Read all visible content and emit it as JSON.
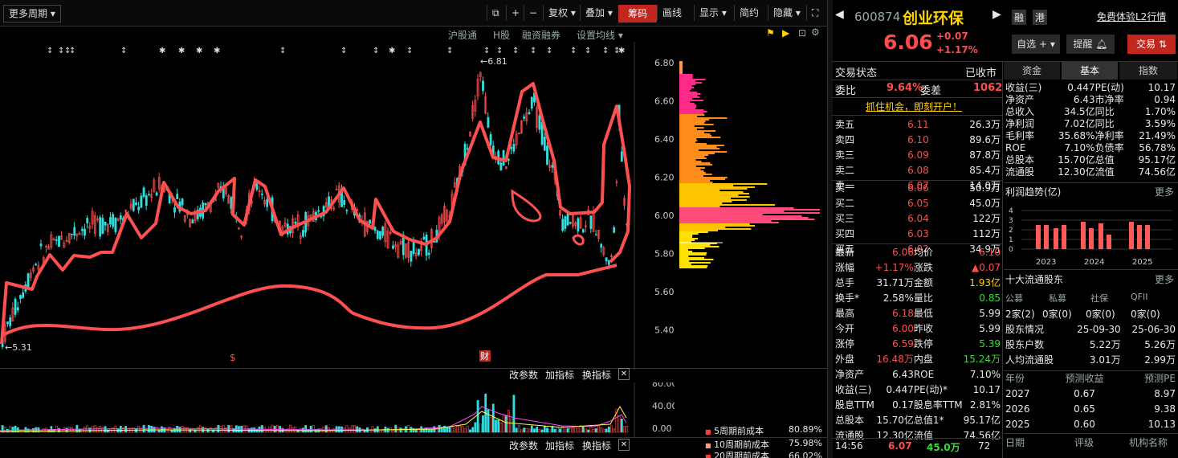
{
  "toolbar": {
    "period": "更多周期",
    "restore": "复权",
    "overlay": "叠加",
    "chips": "筹码",
    "draw": "画线",
    "display": "显示",
    "simple": "简约",
    "hide": "隐藏"
  },
  "subbar": {
    "hk_connect": "沪股通",
    "h_share": "H股",
    "margin": "融资融券",
    "ma_setting": "设置均线"
  },
  "price_axis": [
    "6.80",
    "6.60",
    "6.40",
    "6.20",
    "6.00",
    "5.80",
    "5.60",
    "5.40"
  ],
  "markers": {
    "high": "6.81",
    "low": "5.31",
    "s_badge": "$",
    "cai_badge": "财"
  },
  "indicator": {
    "change_param": "改参数",
    "add_ind": "加指标",
    "swap_ind": "换指标",
    "close": "✕",
    "axis": [
      "80.00",
      "40.00",
      "0.00"
    ]
  },
  "cost": {
    "rows": [
      {
        "label": "5周期前成本",
        "value": "80.89%"
      },
      {
        "label": "10周期前成本",
        "value": "75.98%"
      },
      {
        "label": "20周期前成本",
        "value": "66.02%"
      }
    ]
  },
  "stock": {
    "code": "600874",
    "name": "创业环保",
    "price": "6.06",
    "change": "+0.07",
    "pct": "+1.17%",
    "rong": "融",
    "gang": "港",
    "l2": "免费体验L2行情",
    "watch": "自选",
    "remind": "提醒",
    "trade": "交易"
  },
  "status": {
    "label": "交易状态",
    "value": "已收市",
    "wb_label": "委比",
    "wb": "9.64%",
    "wc_label": "委差",
    "wc": "1062",
    "banner": "抓住机会，即刻开户！"
  },
  "asks": [
    {
      "label": "卖五",
      "price": "6.11",
      "vol": "26.3万"
    },
    {
      "label": "卖四",
      "price": "6.10",
      "vol": "89.6万"
    },
    {
      "label": "卖三",
      "price": "6.09",
      "vol": "87.8万"
    },
    {
      "label": "卖二",
      "price": "6.08",
      "vol": "85.4万"
    },
    {
      "label": "卖一",
      "price": "6.07",
      "vol": "14.0万"
    }
  ],
  "bids": [
    {
      "label": "买一",
      "price": "6.06",
      "vol": "50.9万"
    },
    {
      "label": "买二",
      "price": "6.05",
      "vol": "45.0万"
    },
    {
      "label": "买三",
      "price": "6.04",
      "vol": "122万"
    },
    {
      "label": "买四",
      "price": "6.03",
      "vol": "112万"
    },
    {
      "label": "买五",
      "price": "6.02",
      "vol": "34.9万"
    }
  ],
  "stats": [
    {
      "l1": "最新",
      "v1": "6.06",
      "c1": "red",
      "l2": "均价",
      "v2": "6.10",
      "c2": "red"
    },
    {
      "l1": "涨幅",
      "v1": "+1.17%",
      "c1": "red",
      "l2": "涨跌",
      "v2": "▲0.07",
      "c2": "red"
    },
    {
      "l1": "总手",
      "v1": "31.71万",
      "c1": "white",
      "l2": "金额",
      "v2": "1.93亿",
      "c2": "yellow"
    },
    {
      "l1": "换手*",
      "v1": "2.58%",
      "c1": "white",
      "l2": "量比",
      "v2": "0.85",
      "c2": "green"
    },
    {
      "l1": "最高",
      "v1": "6.18",
      "c1": "red",
      "l2": "最低",
      "v2": "5.99",
      "c2": "white"
    },
    {
      "l1": "今开",
      "v1": "6.00",
      "c1": "red",
      "l2": "昨收",
      "v2": "5.99",
      "c2": "white"
    },
    {
      "l1": "涨停",
      "v1": "6.59",
      "c1": "red",
      "l2": "跌停",
      "v2": "5.39",
      "c2": "green"
    },
    {
      "l1": "外盘",
      "v1": "16.48万",
      "c1": "red",
      "l2": "内盘",
      "v2": "15.24万",
      "c2": "green"
    },
    {
      "l1": "净资产",
      "v1": "6.43",
      "c1": "white",
      "l2": "ROE",
      "v2": "7.10%",
      "c2": "white"
    },
    {
      "l1": "收益(三)",
      "v1": "0.447",
      "c1": "white",
      "l2": "PE(动)*",
      "v2": "10.17",
      "c2": "white"
    },
    {
      "l1": "股息TTM",
      "v1": "0.17",
      "c1": "white",
      "l2": "股息率TTM",
      "v2": "2.81%",
      "c2": "white"
    },
    {
      "l1": "总股本",
      "v1": "15.70亿",
      "c1": "white",
      "l2": "总值1*",
      "v2": "95.17亿",
      "c2": "white"
    },
    {
      "l1": "流通股",
      "v1": "12.30亿",
      "c1": "white",
      "l2": "流值",
      "v2": "74.56亿",
      "c2": "white"
    }
  ],
  "tick": {
    "time": "14:56",
    "price": "6.07",
    "vol": "45.0万",
    "count": "72"
  },
  "tabs": [
    "资金",
    "基本",
    "指数"
  ],
  "fund": [
    {
      "l1": "收益(三)",
      "v1": "0.447",
      "l2": "PE(动)",
      "v2": "10.17"
    },
    {
      "l1": "净资产",
      "v1": "6.43",
      "l2": "市净率",
      "v2": "0.94"
    },
    {
      "l1": "总收入",
      "v1": "34.5亿",
      "l2": "同比",
      "v2": "1.70%"
    },
    {
      "l1": "净利润",
      "v1": "7.02亿",
      "l2": "同比",
      "v2": "3.59%"
    },
    {
      "l1": "毛利率",
      "v1": "35.68%",
      "l2": "净利率",
      "v2": "21.49%"
    },
    {
      "l1": "ROE",
      "v1": "7.10%",
      "l2": "负债率",
      "v2": "56.78%"
    },
    {
      "l1": "总股本",
      "v1": "15.70亿",
      "l2": "总值",
      "v2": "95.17亿"
    },
    {
      "l1": "流通股",
      "v1": "12.30亿",
      "l2": "流值",
      "v2": "74.56亿"
    }
  ],
  "profit": {
    "title": "利润趋势(亿)",
    "more": "更多",
    "axis": [
      "4",
      "3",
      "2",
      "1",
      "0"
    ],
    "years": [
      "2023",
      "2024",
      "2025"
    ]
  },
  "holders": {
    "title": "十大流通股东",
    "more": "更多",
    "heads": [
      "公募",
      "私募",
      "社保",
      "QFII"
    ],
    "vals": [
      "2家(2)",
      "0家(0)",
      "0家(0)",
      "0家(0)"
    ],
    "rows": [
      {
        "l": "股东情况",
        "a": "25-09-30",
        "b": "25-06-30"
      },
      {
        "l": "股东户数",
        "a": "5.22万",
        "b": "5.26万"
      },
      {
        "l": "人均流通股",
        "a": "3.01万",
        "b": "2.99万"
      }
    ]
  },
  "forecast": {
    "heads": [
      "年份",
      "预测收益",
      "预测PE"
    ],
    "rows": [
      {
        "y": "2027",
        "e": "0.67",
        "pe": "8.97"
      },
      {
        "y": "2026",
        "e": "0.65",
        "pe": "9.38"
      },
      {
        "y": "2025",
        "e": "0.60",
        "pe": "10.13"
      }
    ],
    "foot": [
      "日期",
      "评级",
      "机构名称"
    ]
  },
  "colors": {
    "up": "#ff4d4d",
    "down": "#2fe0e0",
    "accent": "#c1271f",
    "yellow": "#ffd200"
  }
}
